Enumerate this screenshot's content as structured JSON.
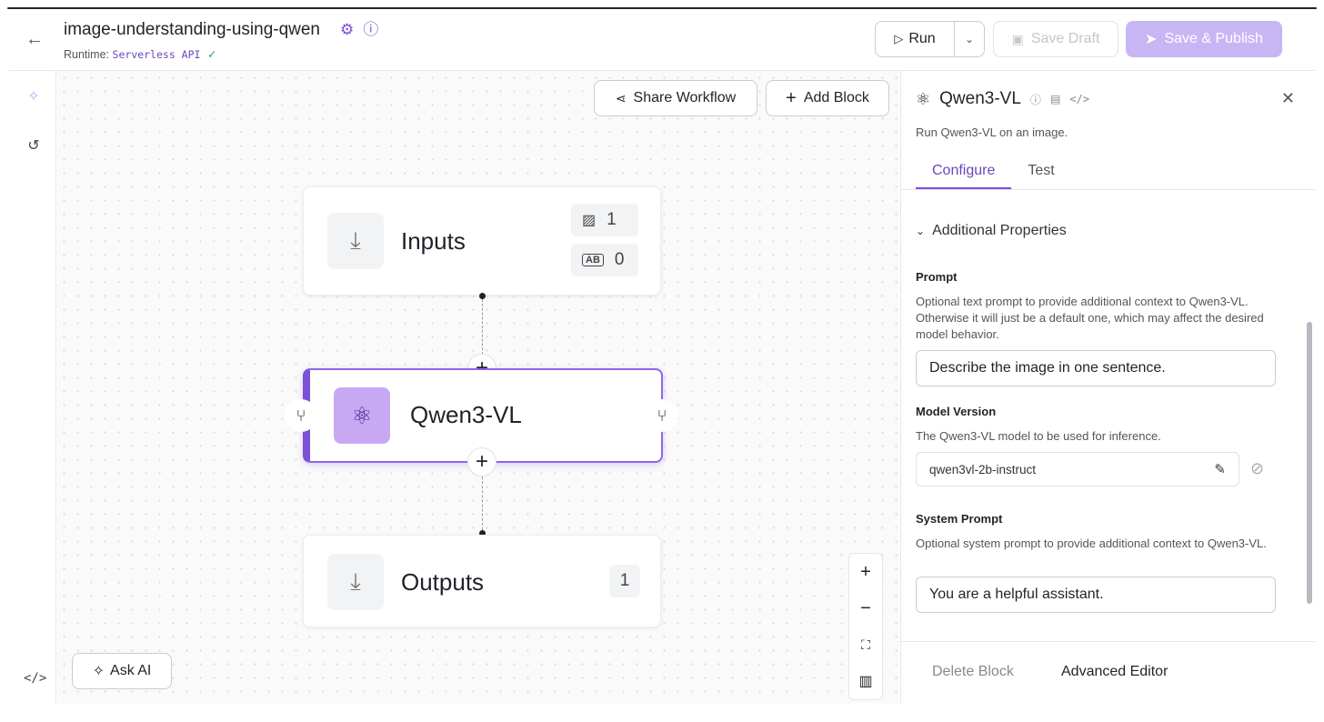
{
  "header": {
    "title": "image-understanding-using-qwen",
    "runtime_label": "Runtime:",
    "runtime_value": "Serverless API",
    "run_label": "Run",
    "save_draft_label": "Save Draft",
    "save_publish_label": "Save & Publish"
  },
  "canvas": {
    "share_label": "Share Workflow",
    "add_block_label": "Add Block",
    "ask_ai_label": "Ask AI",
    "inputs_node": {
      "label": "Inputs",
      "image_count": "1",
      "text_count": "0"
    },
    "qwen_node": {
      "label": "Qwen3-VL"
    },
    "outputs_node": {
      "label": "Outputs",
      "count": "1"
    }
  },
  "panel": {
    "title": "Qwen3-VL",
    "description": "Run Qwen3-VL on an image.",
    "tabs": [
      "Configure",
      "Test"
    ],
    "section_title": "Additional Properties",
    "prompt": {
      "label": "Prompt",
      "description": "Optional text prompt to provide additional context to Qwen3-VL. Otherwise it will just be a default one, which may affect the desired model behavior.",
      "value": "Describe the image in one sentence."
    },
    "model_version": {
      "label": "Model Version",
      "description": "The Qwen3-VL model to be used for inference.",
      "value": "qwen3vl-2b-instruct"
    },
    "system_prompt": {
      "label": "System Prompt",
      "description": "Optional system prompt to provide additional context to Qwen3-VL.",
      "value": "You are a helpful assistant."
    },
    "delete_label": "Delete Block",
    "advanced_label": "Advanced Editor"
  },
  "colors": {
    "accent": "#7b4fd6",
    "publish_bg": "#c8b6f4",
    "node_icon_bg": "#c9a8f3"
  },
  "icons": [
    "back-arrow-icon",
    "gear-icon",
    "help-icon",
    "play-icon",
    "chevron-down-icon",
    "save-icon",
    "send-icon",
    "sparkle-icon",
    "history-icon",
    "code-icon",
    "share-icon",
    "plus-icon",
    "download-icon",
    "image-icon",
    "text-icon",
    "branch-icon",
    "minus-icon",
    "fit-view-icon",
    "map-icon",
    "close-icon",
    "doc-icon",
    "pencil-icon",
    "link-icon"
  ]
}
